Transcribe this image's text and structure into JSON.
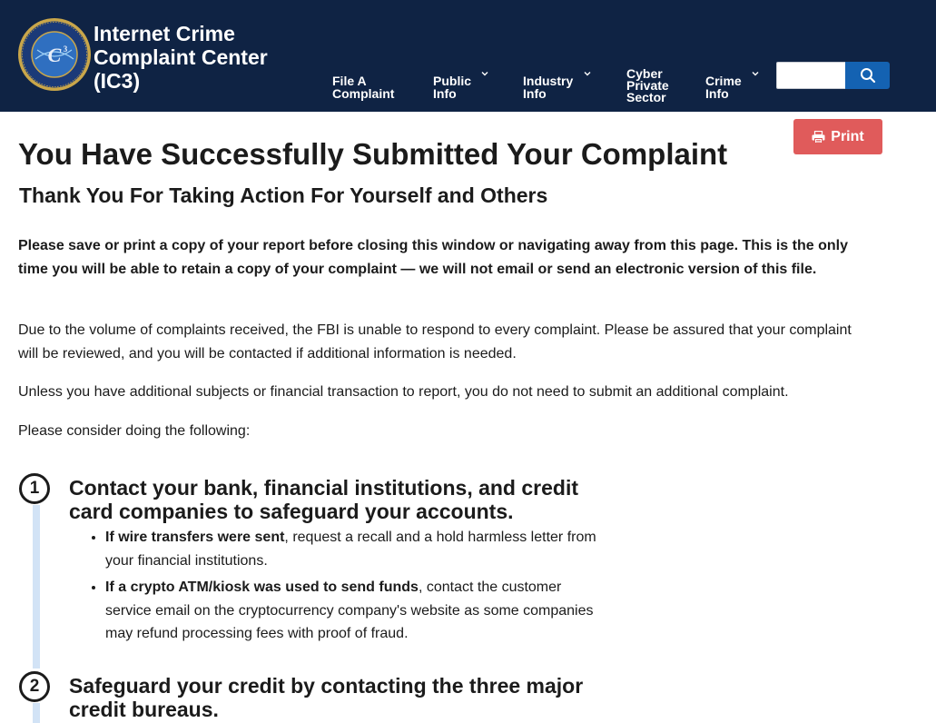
{
  "header": {
    "brand": "Internet Crime\nComplaint Center\n(IC3)",
    "seal_icon": "fbi-ic3-seal",
    "nav": [
      {
        "label": "File A\nComplaint",
        "has_dropdown": false
      },
      {
        "label": "Public\nInfo",
        "has_dropdown": true
      },
      {
        "label": "Industry\nInfo",
        "has_dropdown": true
      },
      {
        "label": "Cyber\nPrivate\nSector",
        "has_dropdown": false
      },
      {
        "label": "Crime\nInfo",
        "has_dropdown": true
      }
    ],
    "search": {
      "placeholder": "",
      "value": "",
      "icon": "search-icon"
    }
  },
  "print_button": {
    "label": "Print",
    "icon": "printer-icon"
  },
  "main": {
    "title": "You Have Successfully Submitted Your Complaint",
    "subtitle": "Thank You For Taking Action For Yourself and Others",
    "notice": "Please save or print a copy of your report before closing this window or navigating away from this page. This is the only time you will be able to retain a copy of your complaint — we will not email or send an electronic version of this file.",
    "para_volume": "Due to the volume of complaints received, the FBI is unable to respond to every complaint. Please be assured that your complaint will be reviewed, and you will be contacted if additional information is needed.",
    "para_subjects": "Unless you have additional subjects or financial transaction to report, you do not need to submit an additional complaint.",
    "para_consider": "Please consider doing the following:"
  },
  "steps": [
    {
      "number": "1",
      "title": "Contact your bank, financial institutions, and credit card companies to safeguard your accounts.",
      "items": [
        {
          "bold": "If wire transfers were sent",
          "text": ", request a recall and a hold harmless letter from your financial institutions."
        },
        {
          "bold": "If a crypto ATM/kiosk was used to send funds",
          "text": ", contact the customer service email on the cryptocurrency company's website as some companies may refund processing fees with proof of fraud."
        }
      ]
    },
    {
      "number": "2",
      "title": "Safeguard your credit by contacting the three major credit bureaus."
    }
  ],
  "colors": {
    "header_bg": "#0f2344",
    "search_button": "#1462b2",
    "print_button": "#e05b5b",
    "step_line": "#d2e3f6"
  }
}
